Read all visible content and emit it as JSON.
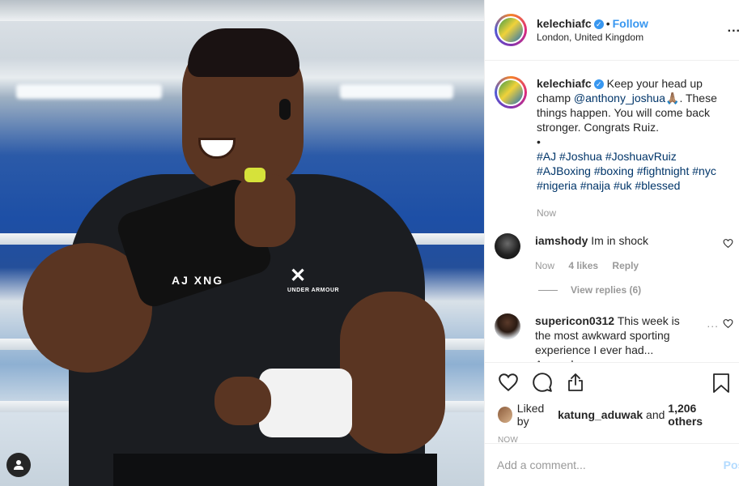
{
  "header": {
    "username": "kelechiafc",
    "follow": "Follow",
    "separator": "•",
    "location": "London, United Kingdom",
    "more": "..."
  },
  "photo": {
    "shirt_text_left": "AJ XNG",
    "shirt_brand": "UNDER ARMOUR"
  },
  "caption": {
    "username": "kelechiafc",
    "text_before": "Keep your head up champ ",
    "mention": "@anthony_joshua",
    "emoji": "🙏🏽",
    "text_after": ". These things happen. You will come back stronger. Congrats Ruiz.",
    "bullet": "•",
    "hashtags": "#AJ #Joshua #JoshuavRuiz #AJBoxing #boxing #fightnight #nyc #nigeria #naija #uk #blessed",
    "time": "Now"
  },
  "comments": [
    {
      "username": "iamshody",
      "text": "Im in shock",
      "time": "Now",
      "likes": "4 likes",
      "reply": "Reply",
      "view_replies": "View replies (6)"
    },
    {
      "username": "supericon0312",
      "text": "This week is the most awkward sporting experience I ever had... Arsenal",
      "more": "..."
    }
  ],
  "likes": {
    "prefix": "Liked by ",
    "user": "katung_aduwak",
    "middle": " and ",
    "others": "1,206 others"
  },
  "timestamp": "Now",
  "add_comment": {
    "placeholder": "Add a comment...",
    "post": "Post"
  },
  "colors": {
    "accent": "#3897f0",
    "link": "#003569",
    "muted": "#999999",
    "post_disabled": "#b3dbff"
  }
}
